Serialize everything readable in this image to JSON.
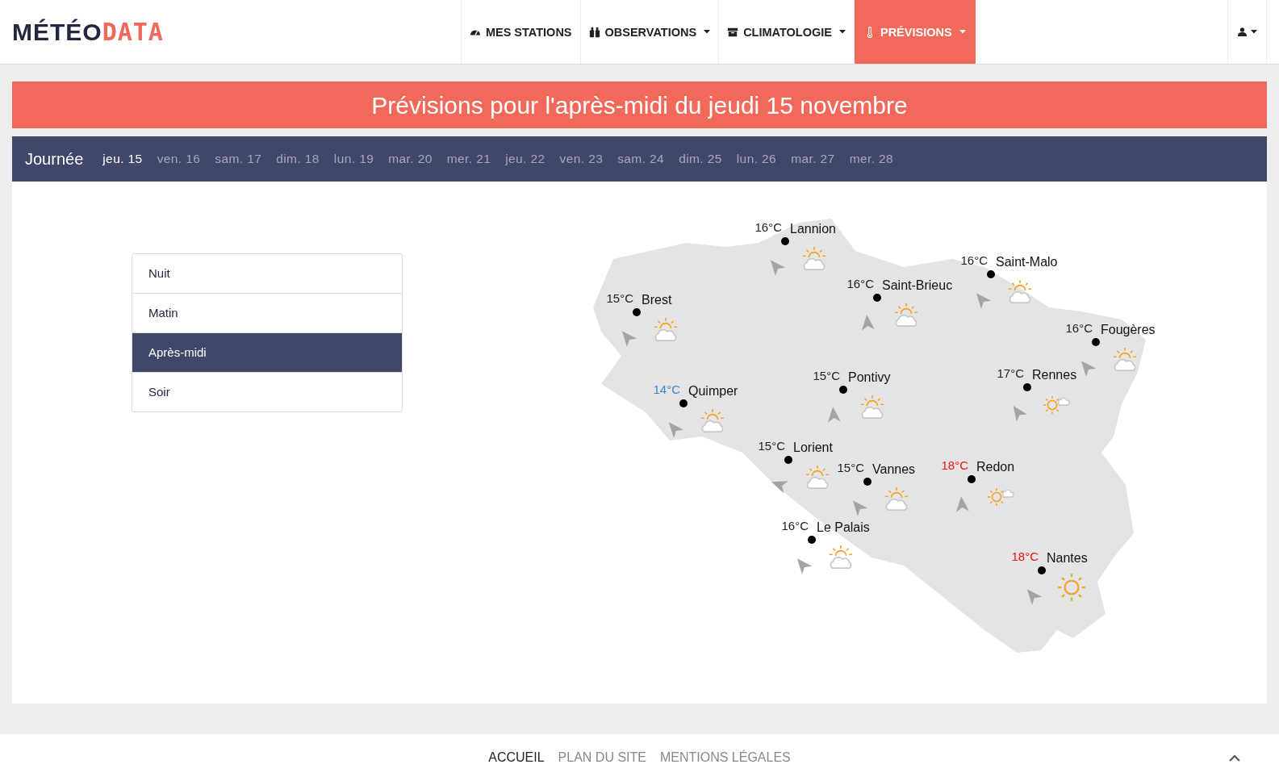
{
  "logo": {
    "dark": "MÉTÉO",
    "accent": "DATA"
  },
  "nav": [
    {
      "label": "MES STATIONS",
      "dropdown": false,
      "selected": false
    },
    {
      "label": "OBSERVATIONS",
      "dropdown": true,
      "selected": false
    },
    {
      "label": "CLIMATOLOGIE",
      "dropdown": true,
      "selected": false
    },
    {
      "label": "PRÉVISIONS",
      "dropdown": true,
      "selected": true
    }
  ],
  "banner": "Prévisions pour l'après-midi du jeudi 15 novembre",
  "days": {
    "label": "Journée",
    "items": [
      {
        "label": "jeu. 15",
        "selected": true
      },
      {
        "label": "ven. 16",
        "selected": false
      },
      {
        "label": "sam. 17",
        "selected": false
      },
      {
        "label": "dim. 18",
        "selected": false
      },
      {
        "label": "lun. 19",
        "selected": false
      },
      {
        "label": "mar. 20",
        "selected": false
      },
      {
        "label": "mer. 21",
        "selected": false
      },
      {
        "label": "jeu. 22",
        "selected": false
      },
      {
        "label": "ven. 23",
        "selected": false
      },
      {
        "label": "sam. 24",
        "selected": false
      },
      {
        "label": "dim. 25",
        "selected": false
      },
      {
        "label": "lun. 26",
        "selected": false
      },
      {
        "label": "mar. 27",
        "selected": false
      },
      {
        "label": "mer. 28",
        "selected": false
      }
    ]
  },
  "periods": [
    {
      "label": "Nuit",
      "selected": false
    },
    {
      "label": "Matin",
      "selected": false
    },
    {
      "label": "Après-midi",
      "selected": true
    },
    {
      "label": "Soir",
      "selected": false
    }
  ],
  "cities": [
    {
      "temp": "16°C",
      "name": "Lannion",
      "color": "#222222",
      "kind": "partly-cloudy"
    },
    {
      "temp": "16°C",
      "name": "Saint-Malo",
      "color": "#222222",
      "kind": "partly-cloudy"
    },
    {
      "temp": "16°C",
      "name": "Saint-Brieuc",
      "color": "#222222",
      "kind": "partly-cloudy"
    },
    {
      "temp": "15°C",
      "name": "Brest",
      "color": "#222222",
      "kind": "partly-cloudy"
    },
    {
      "temp": "16°C",
      "name": "Fougères",
      "color": "#222222",
      "kind": "partly-cloudy"
    },
    {
      "temp": "17°C",
      "name": "Rennes",
      "color": "#222222",
      "kind": "sun-small-cloud"
    },
    {
      "temp": "15°C",
      "name": "Pontivy",
      "color": "#222222",
      "kind": "partly-cloudy"
    },
    {
      "temp": "14°C",
      "name": "Quimper",
      "color": "#3a87c8",
      "kind": "partly-cloudy"
    },
    {
      "temp": "15°C",
      "name": "Lorient",
      "color": "#222222",
      "kind": "partly-cloudy"
    },
    {
      "temp": "15°C",
      "name": "Vannes",
      "color": "#222222",
      "kind": "partly-cloudy"
    },
    {
      "temp": "18°C",
      "name": "Redon",
      "color": "#ee1111",
      "kind": "sun-small-cloud"
    },
    {
      "temp": "16°C",
      "name": "Le Palais",
      "color": "#222222",
      "kind": "partly-cloudy"
    },
    {
      "temp": "18°C",
      "name": "Nantes",
      "color": "#ee1111",
      "kind": "sunny"
    }
  ],
  "footer": [
    {
      "label": "ACCUEIL",
      "selected": true
    },
    {
      "label": "PLAN DU SITE",
      "selected": false
    },
    {
      "label": "MENTIONS LÉGALES",
      "selected": false
    }
  ]
}
